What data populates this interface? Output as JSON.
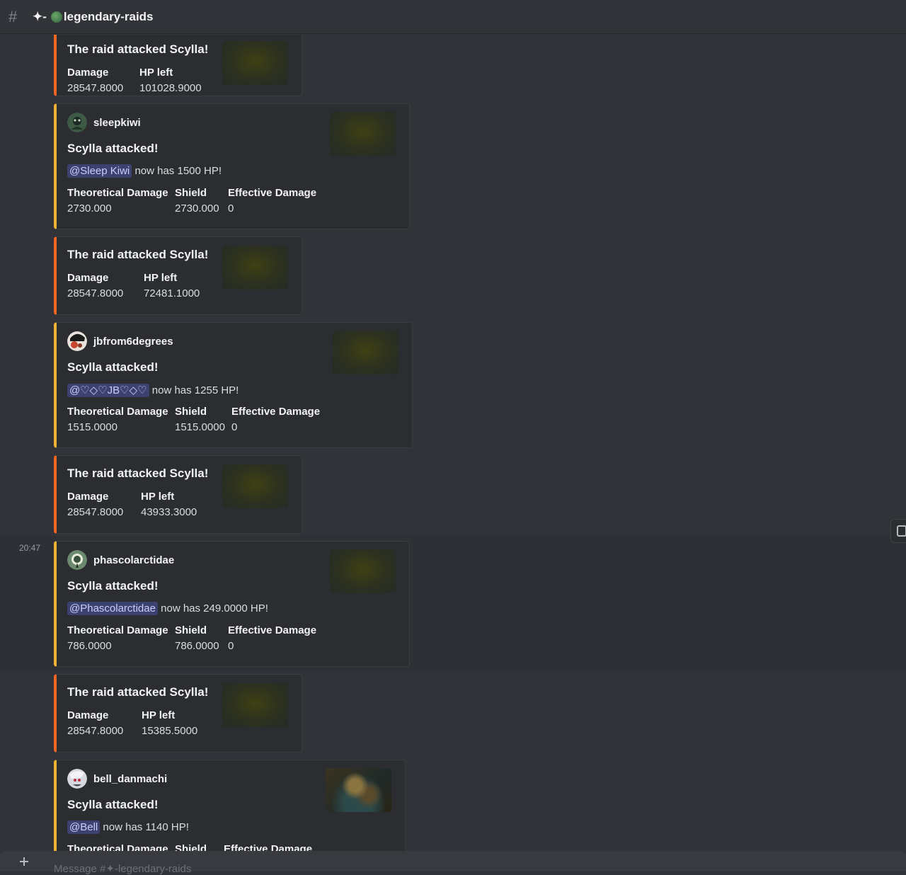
{
  "channel": {
    "sparkle": "✦-",
    "name": "legendary-raids"
  },
  "raid_title": "The raid attacked Scylla!",
  "attack_title": "Scylla attacked!",
  "labels": {
    "damage": "Damage",
    "hp_left": "HP left",
    "theoretical": "Theoretical Damage",
    "shield": "Shield",
    "effective": "Effective Damage",
    "now_has_prefix": "now has",
    "hp_suffix": "HP!"
  },
  "raid_embeds": [
    {
      "damage": "28547.8000",
      "hp_left": "101028.9000"
    },
    {
      "damage": "28547.8000",
      "hp_left": "72481.1000"
    },
    {
      "damage": "28547.8000",
      "hp_left": "43933.3000"
    },
    {
      "damage": "28547.8000",
      "hp_left": "15385.5000"
    }
  ],
  "attack_embeds": [
    {
      "author": "sleepkiwi",
      "mention": "@Sleep Kiwi",
      "now_has": "now has 1500 HP!",
      "theoretical": "2730.000",
      "shield": "2730.000",
      "effective": "0"
    },
    {
      "author": "jbfrom6degrees",
      "mention": "@♡◇♡JB♡◇♡",
      "now_has": "now has 1255 HP!",
      "theoretical": "1515.0000",
      "shield": "1515.0000",
      "effective": "0"
    },
    {
      "author": "phascolarctidae",
      "mention": "@Phascolarctidae",
      "now_has": "now has 249.0000 HP!",
      "theoretical": "786.0000",
      "shield": "786.0000",
      "effective": "0"
    },
    {
      "author": "bell_danmachi",
      "mention": "@Bell",
      "now_has": "now has 1140 HP!",
      "theoretical": "",
      "shield": "",
      "effective": ""
    }
  ],
  "timestamp": "20:47",
  "composer": {
    "placeholder": "Message #✦-legendary-raids"
  },
  "colors": {
    "attack_bar": "#f0b232",
    "raid_bar": "#f26522",
    "mention_bg": "#3c4270"
  },
  "icons": {
    "channel": "hash-icon",
    "composer": "plus-icon",
    "side": "app-icon"
  }
}
